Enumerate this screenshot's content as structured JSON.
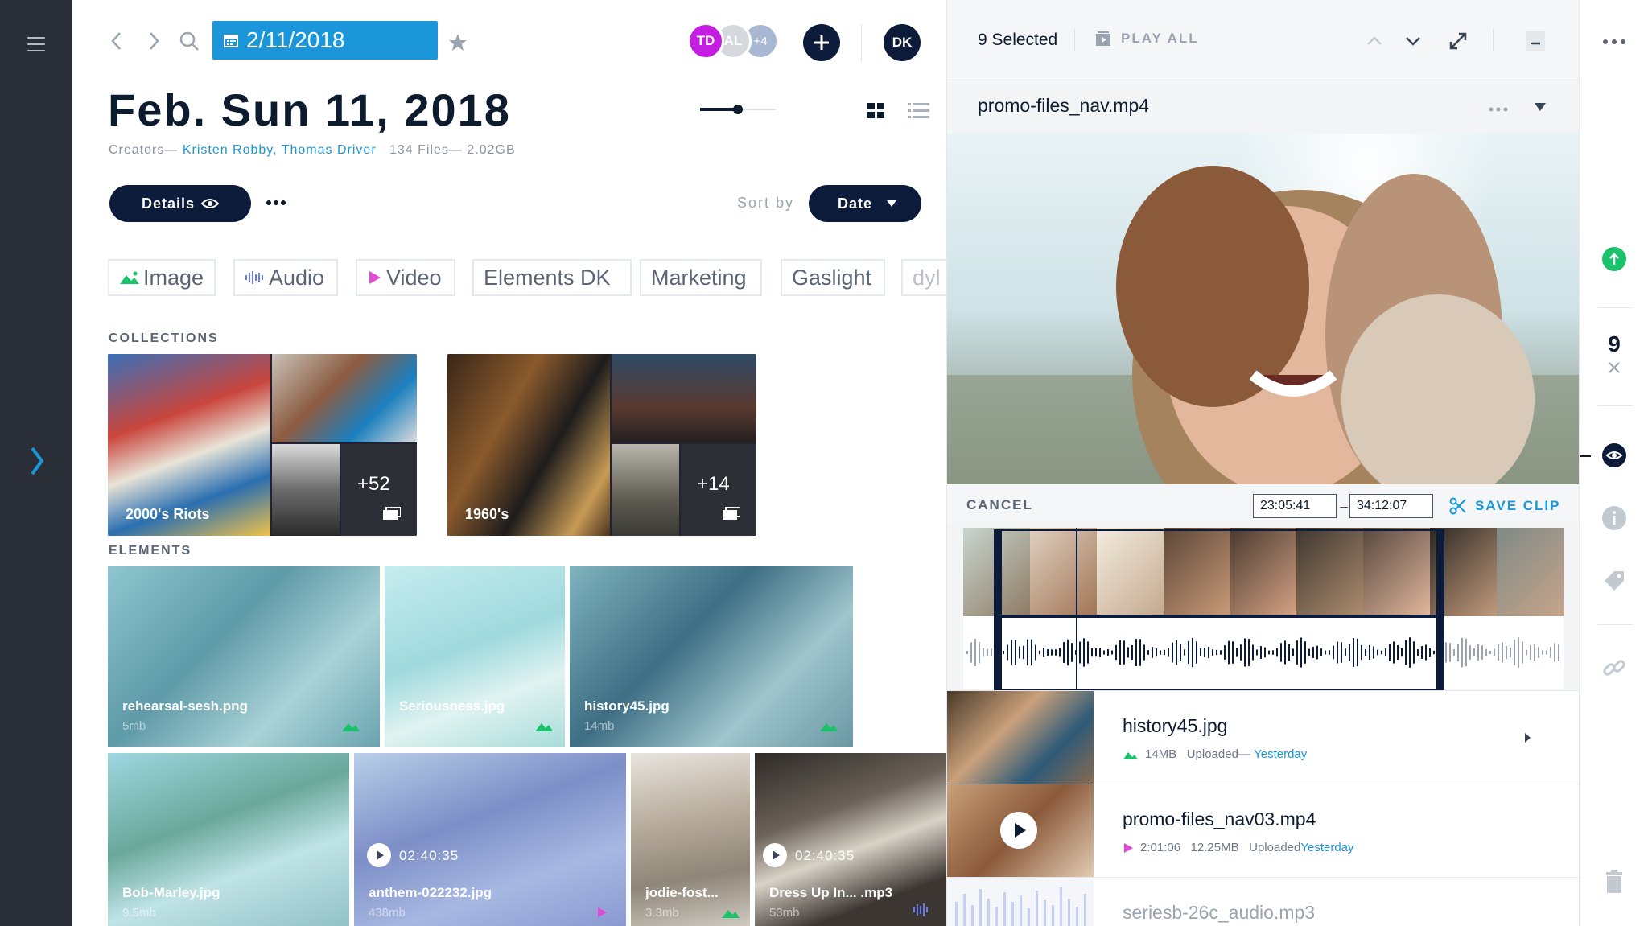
{
  "header": {
    "date_button": "2/11/2018",
    "avatars": [
      {
        "initials": "TD",
        "color": "#c21de0"
      },
      {
        "initials": "AL",
        "color": "#d5d8dd"
      },
      {
        "initials": "+4",
        "color": "#a8b8d2"
      }
    ],
    "user_initials": "DK"
  },
  "page": {
    "title": "Feb. Sun 11, 2018",
    "creators_label": "Creators—",
    "creator_1": "Kristen Robby",
    "creator_sep": ",",
    "creator_2": "Thomas Driver",
    "files_info": "134 Files— 2.02GB",
    "zoom_level": 0.5
  },
  "toolbar": {
    "details_label": "Details",
    "sort_label": "Sort by",
    "sort_value": "Date"
  },
  "tags": [
    "Image",
    "Audio",
    "Video",
    "Elements DK",
    "Marketing",
    "Gaslight",
    "dyl"
  ],
  "sections": {
    "collections": "COLLECTIONS",
    "elements": "ELEMENTS"
  },
  "collections": [
    {
      "name": "2000's Riots",
      "count": "+52"
    },
    {
      "name": "1960's",
      "count": "+14"
    }
  ],
  "elements": [
    {
      "name": "rehearsal-sesh.png",
      "size": "5mb"
    },
    {
      "name": "Seriousness.jpg",
      "size": ""
    },
    {
      "name": "history45.jpg",
      "size": "14mb"
    },
    {
      "name": "Bob-Marley.jpg",
      "size": "9.5mb"
    },
    {
      "name": "anthem-022232.jpg",
      "size": "438mb",
      "duration": "02:40:35"
    },
    {
      "name": "jodie-fost...",
      "size": "3.3mb"
    },
    {
      "name": "Dress Up In... .mp3",
      "size": "53mb",
      "duration": "02:40:35"
    }
  ],
  "panel": {
    "selected": "9 Selected",
    "play_all": "PLAY ALL",
    "filename": "promo-files_nav.mp4",
    "cancel": "CANCEL",
    "time_start": "23:05:41",
    "time_end": "34:12:07",
    "save_clip": "SAVE CLIP"
  },
  "list": [
    {
      "name": "history45.jpg",
      "size": "14MB",
      "uploaded_label": "Uploaded—",
      "uploaded_value": "Yesterday"
    },
    {
      "name": "promo-files_nav03.mp4",
      "duration": "2:01:06",
      "size": "12.25MB",
      "uploaded_label": "Uploaded",
      "uploaded_value": "Yesterday"
    },
    {
      "name": "seriesb-26c_audio.mp3"
    }
  ],
  "right_rail": {
    "count": "9"
  },
  "colors": {
    "accent": "#1b96d8",
    "navy": "#0d1b3a",
    "green": "#19c26b",
    "rail": "#2a2f37"
  }
}
